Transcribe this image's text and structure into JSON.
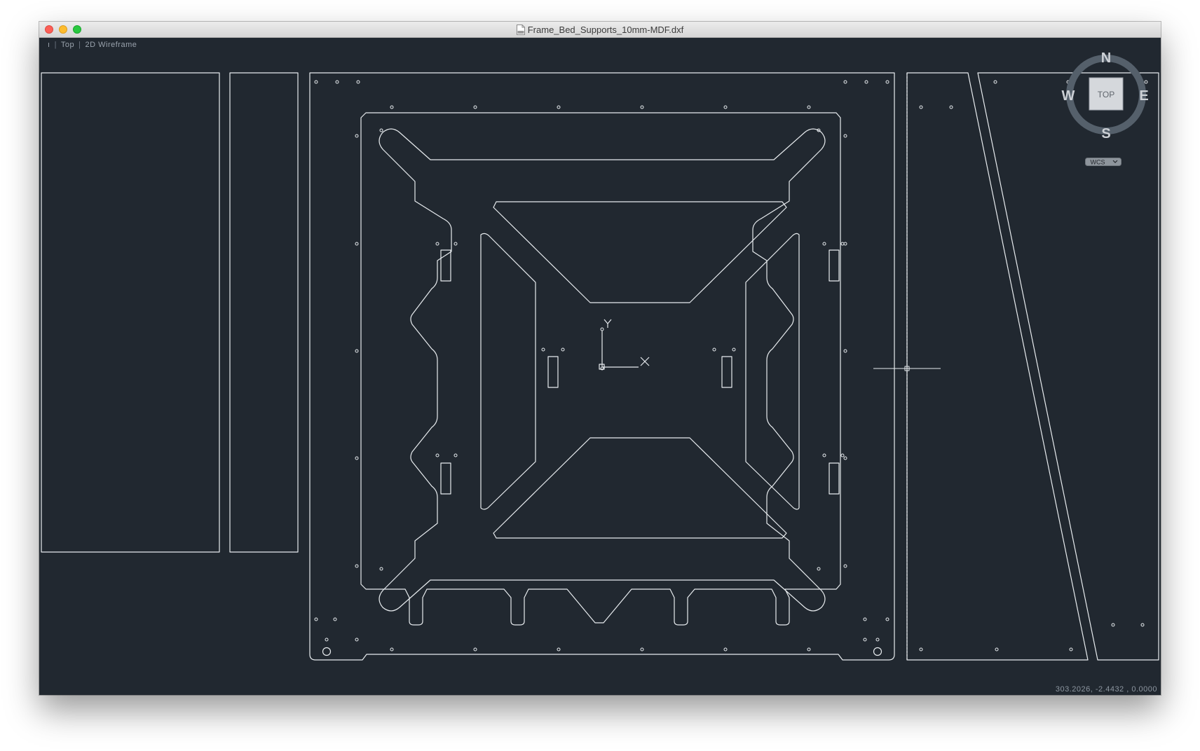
{
  "window": {
    "title": "Frame_Bed_Supports_10mm-MDF.dxf",
    "file_icon": "dxf-document-icon"
  },
  "viewport_controls": {
    "menu_glyph": "ı",
    "view_name": "Top",
    "visual_style": "2D Wireframe"
  },
  "viewcube": {
    "north": "N",
    "south": "S",
    "east": "E",
    "west": "W",
    "face": "TOP",
    "ucs_menu": "WCS"
  },
  "ucs_icon": {
    "x_label": "X",
    "y_label": "Y"
  },
  "status": {
    "coordinates": "303.2026,  -2.4432  , 0.0000"
  },
  "colors": {
    "background": "#212830",
    "linework": "#e8ecef",
    "titlebar": "#dcdcdc"
  }
}
